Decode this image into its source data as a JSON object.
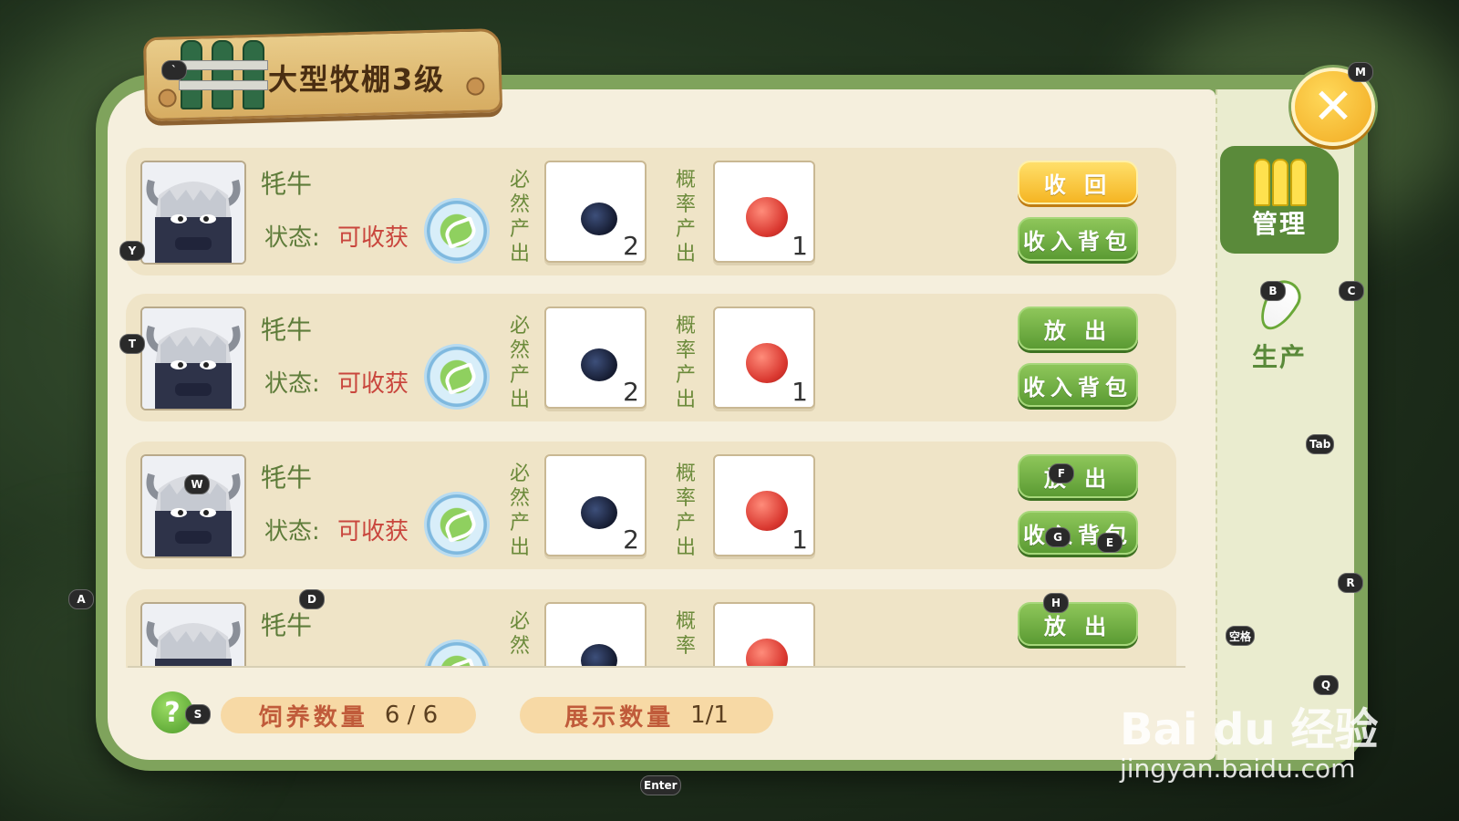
{
  "window": {
    "title": "大型牧棚3级"
  },
  "controls": {
    "close_icon": "close-x-icon",
    "close_glyph": "✕"
  },
  "labels": {
    "status_label": "状态:",
    "guaranteed_label": [
      "必",
      "然",
      "产",
      "出"
    ],
    "chance_label": [
      "概",
      "率",
      "产",
      "出"
    ]
  },
  "animals": [
    {
      "name": "牦牛",
      "status": "可收获",
      "guaranteed_qty": "2",
      "chance_qty": "1",
      "primary_button": "收 回",
      "primary_style": "yellow",
      "secondary_button": "收入背包"
    },
    {
      "name": "牦牛",
      "status": "可收获",
      "guaranteed_qty": "2",
      "chance_qty": "1",
      "primary_button": "放 出",
      "primary_style": "green",
      "secondary_button": "收入背包"
    },
    {
      "name": "牦牛",
      "status": "可收获",
      "guaranteed_qty": "2",
      "chance_qty": "1",
      "primary_button": "放 出",
      "primary_style": "green",
      "secondary_button": "收入背包"
    },
    {
      "name": "牦牛",
      "status": "",
      "guaranteed_qty": "",
      "chance_qty": "",
      "primary_button": "放 出",
      "primary_style": "green",
      "secondary_button": ""
    }
  ],
  "footer": {
    "help_glyph": "?",
    "feed_label": "饲养数量",
    "feed_value": "6 / 6",
    "display_label": "展示数量",
    "display_value": "1/1"
  },
  "side_tabs": {
    "manage": {
      "label": "管理",
      "color": "#5a8a3a",
      "text_color": "#ffffff",
      "icon": "fence-icon",
      "active": true
    },
    "production": {
      "label": "生产",
      "text_color": "#5a8a3a",
      "icon": "carrot-icon",
      "active": false
    }
  },
  "key_hints": {
    "M": "M",
    "Y": "Y",
    "T": "T",
    "W": "W",
    "A": "A",
    "D": "D",
    "B": "B",
    "C": "C",
    "Tab": "Tab",
    "F": "F",
    "G": "G",
    "E": "E",
    "H": "H",
    "R": "R",
    "space": "空格",
    "Q": "Q",
    "S": "S",
    "Enter": "Enter",
    "backtick": "`"
  },
  "watermark": {
    "brand": "Bai du 经验",
    "url": "jingyan.baidu.com"
  },
  "colors": {
    "panel_green": "#7fa35c",
    "parchment": "#f5efdd",
    "status_red": "#c9463d",
    "button_green": "#6aa838",
    "button_yellow": "#f5b523"
  }
}
